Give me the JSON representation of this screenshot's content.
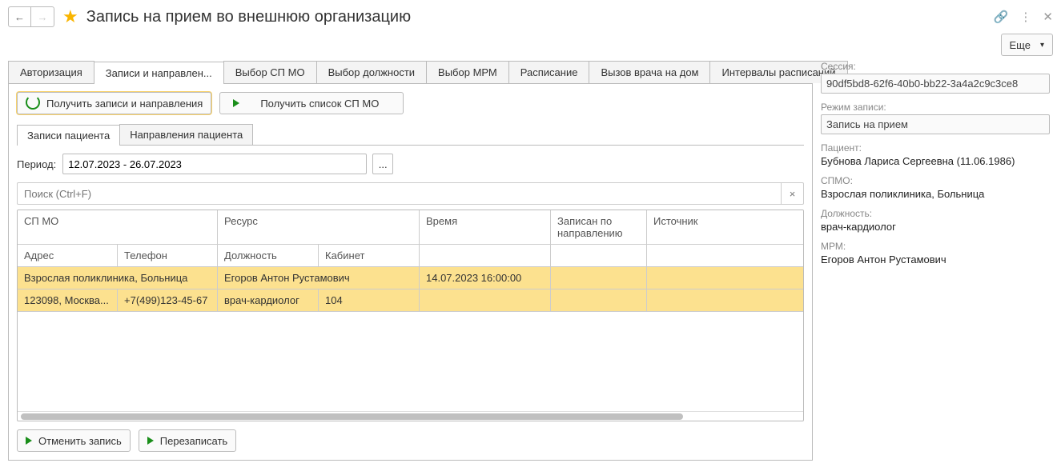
{
  "titlebar": {
    "back": "←",
    "fwd": "→",
    "title": "Запись на прием во внешнюю организацию",
    "link": "🔗",
    "menu": "⋮",
    "close": "✕"
  },
  "more_btn": "Еще",
  "tabs": [
    "Авторизация",
    "Записи и направлен...",
    "Выбор СП МО",
    "Выбор должности",
    "Выбор МРМ",
    "Расписание",
    "Вызов врача на дом",
    "Интервалы расписаний"
  ],
  "toolbar": {
    "get_records": "Получить записи и направления",
    "get_spmo": "Получить список СП МО"
  },
  "subtabs": [
    "Записи пациента",
    "Направления пациента"
  ],
  "period": {
    "label": "Период:",
    "value": "12.07.2023 - 26.07.2023",
    "dots": "..."
  },
  "search": {
    "placeholder": "Поиск (Ctrl+F)",
    "close": "×"
  },
  "table": {
    "h1": {
      "spmo": "СП МО",
      "res": "Ресурс",
      "time": "Время",
      "ref": "Записан по направлению",
      "src": "Источник"
    },
    "h2": {
      "addr": "Адрес",
      "tel": "Телефон",
      "pos": "Должность",
      "cab": "Кабинет"
    },
    "r1": {
      "spmo": "Взрослая поликлиника, Больница",
      "res": "Егоров Антон Рустамович",
      "time": "14.07.2023 16:00:00",
      "ref": "",
      "src": ""
    },
    "r2": {
      "addr": "123098, Москва...",
      "tel": "+7(499)123-45-67",
      "pos": "врач-кардиолог",
      "cab": "104"
    }
  },
  "footer": {
    "cancel": "Отменить запись",
    "rebook": "Перезаписать"
  },
  "sidebar": {
    "session_lab": "Сессия:",
    "session": "90df5bd8-62f6-40b0-bb22-3a4a2c9c3ce8",
    "mode_lab": "Режим записи:",
    "mode": "Запись на прием",
    "patient_lab": "Пациент:",
    "patient": "Бубнова Лариса Сергеевна (11.06.1986)",
    "spmo_lab": "СПМО:",
    "spmo": "Взрослая поликлиника, Больница",
    "pos_lab": "Должность:",
    "pos": "врач-кардиолог",
    "mrm_lab": "МРМ:",
    "mrm": "Егоров Антон Рустамович"
  }
}
